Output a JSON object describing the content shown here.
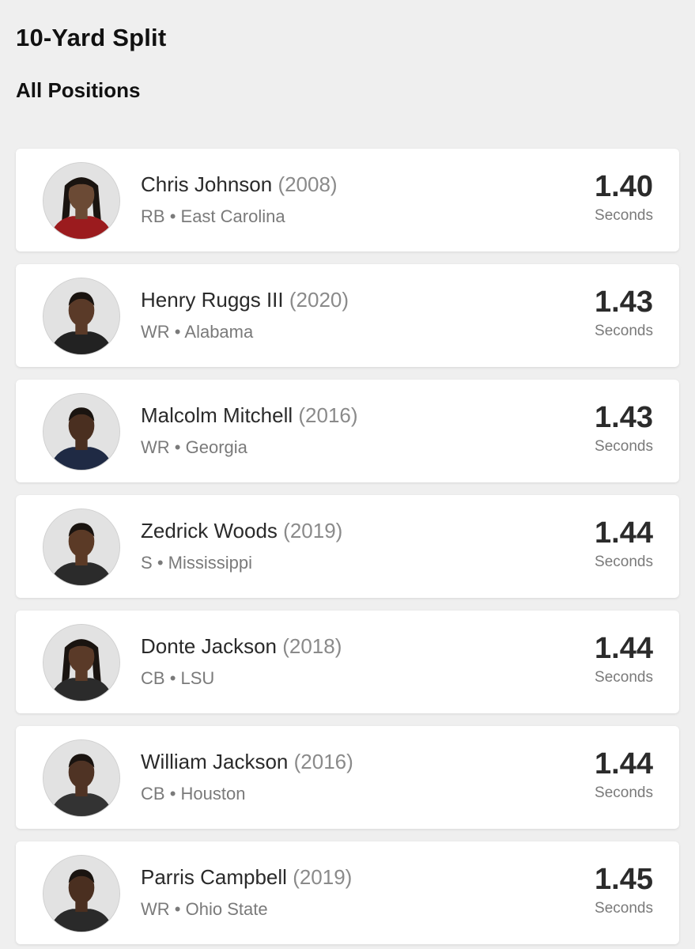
{
  "header": {
    "title": "10-Yard Split",
    "subtitle": "All Positions"
  },
  "players": [
    {
      "name": "Chris Johnson",
      "year": "(2008)",
      "position": "RB",
      "school": "East Carolina",
      "time": "1.40",
      "unit": "Seconds",
      "jersey": "#9b1b1e",
      "skin": "#6b4a35",
      "hair": "dreads"
    },
    {
      "name": "Henry Ruggs III",
      "year": "(2020)",
      "position": "WR",
      "school": "Alabama",
      "time": "1.43",
      "unit": "Seconds",
      "jersey": "#222222",
      "skin": "#5a3a28",
      "hair": "short"
    },
    {
      "name": "Malcolm Mitchell",
      "year": "(2016)",
      "position": "WR",
      "school": "Georgia",
      "time": "1.43",
      "unit": "Seconds",
      "jersey": "#1f2a44",
      "skin": "#4a2f20",
      "hair": "short"
    },
    {
      "name": "Zedrick Woods",
      "year": "(2019)",
      "position": "S",
      "school": "Mississippi",
      "time": "1.44",
      "unit": "Seconds",
      "jersey": "#2b2b2b",
      "skin": "#5b3a26",
      "hair": "short"
    },
    {
      "name": "Donte Jackson",
      "year": "(2018)",
      "position": "CB",
      "school": "LSU",
      "time": "1.44",
      "unit": "Seconds",
      "jersey": "#2b2b2b",
      "skin": "#5a3a28",
      "hair": "dreads"
    },
    {
      "name": "William Jackson",
      "year": "(2016)",
      "position": "CB",
      "school": "Houston",
      "time": "1.44",
      "unit": "Seconds",
      "jersey": "#333333",
      "skin": "#4f3324",
      "hair": "short"
    },
    {
      "name": "Parris Campbell",
      "year": "(2019)",
      "position": "WR",
      "school": "Ohio State",
      "time": "1.45",
      "unit": "Seconds",
      "jersey": "#2a2a2a",
      "skin": "#4a2f20",
      "hair": "short"
    }
  ],
  "separator": "•"
}
